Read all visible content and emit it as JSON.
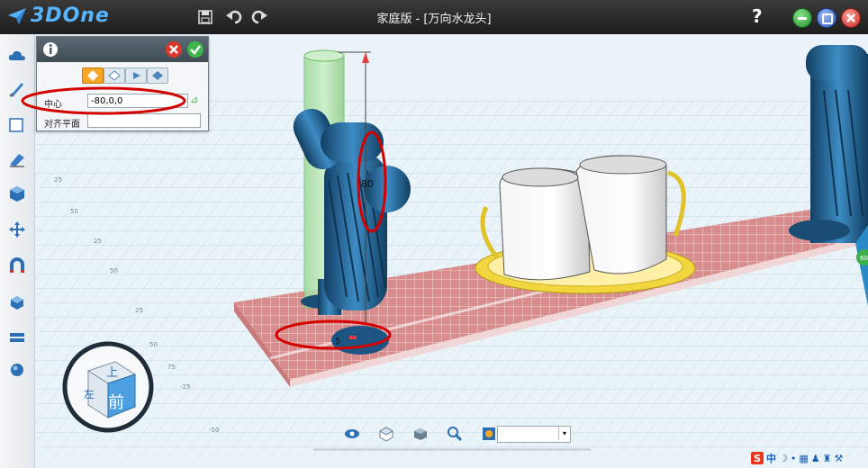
{
  "app": {
    "logo_text": "3DOne",
    "title": "家庭版 - [万向水龙头]",
    "help_label": "?"
  },
  "window_buttons": [
    {
      "name": "minimize",
      "color": "#2fae3c"
    },
    {
      "name": "restore",
      "color": "#3b6fd8"
    },
    {
      "name": "close",
      "color": "#d9362b"
    }
  ],
  "toolbar_icons": [
    "save-icon",
    "undo-icon",
    "redo-icon"
  ],
  "sidebar": {
    "items": [
      "cloud-icon",
      "sketch-icon",
      "sketch-edit-icon",
      "feature-icon",
      "solid-icon",
      "move-icon",
      "magnet-icon",
      "combine-icon",
      "layers-icon",
      "sphere-icon"
    ]
  },
  "panel": {
    "info_icon": "info-icon",
    "center_label": "中心",
    "center_value": "-80,0,0",
    "align_label": "对齐平面",
    "align_value": ""
  },
  "viewport": {
    "dimension_height": "80",
    "dimension_radius": "5",
    "side_badge": "60",
    "view_cube_top": "上",
    "view_cube_front": "前",
    "view_cube_left": "左",
    "grid_labels": [
      "25",
      "50",
      "25",
      "50",
      "25",
      "50",
      "75",
      "-25",
      "-50"
    ]
  },
  "bottom_toolbar": [
    "view-icon",
    "cube-icon",
    "box-icon",
    "search-icon",
    "render-icon"
  ],
  "ime": {
    "logo": "S",
    "text": "中"
  }
}
